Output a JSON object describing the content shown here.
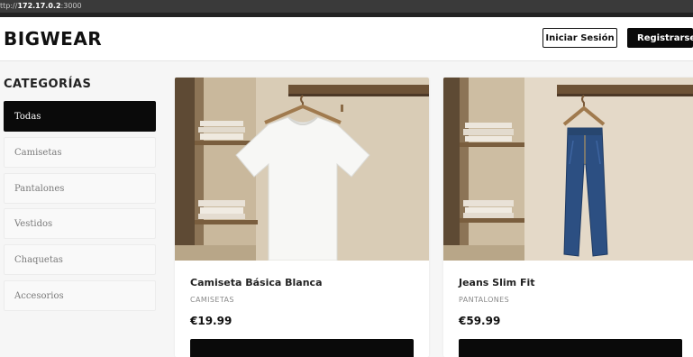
{
  "browser": {
    "url_prefix": "ttp://",
    "url_host": "172.17.0.2",
    "url_port": ":3000"
  },
  "header": {
    "logo": "BIGWEAR",
    "login_label": "Iniciar Sesión",
    "register_label": "Registrarse"
  },
  "sidebar": {
    "title": "CATEGORÍAS",
    "items": [
      {
        "label": "Todas",
        "active": true
      },
      {
        "label": "Camisetas"
      },
      {
        "label": "Pantalones"
      },
      {
        "label": "Vestidos"
      },
      {
        "label": "Chaquetas"
      },
      {
        "label": "Accesorios"
      }
    ]
  },
  "products": [
    {
      "name": "Camiseta Básica Blanca",
      "category": "CAMISETAS",
      "price": "€19.99",
      "image": "white-tshirt-on-hanger"
    },
    {
      "name": "Jeans Slim Fit",
      "category": "PANTALONES",
      "price": "€59.99",
      "image": "blue-jeans-on-hanger"
    }
  ],
  "colors": {
    "accent": "#0a0a0a",
    "background": "#f6f6f6",
    "card": "#ffffff"
  }
}
